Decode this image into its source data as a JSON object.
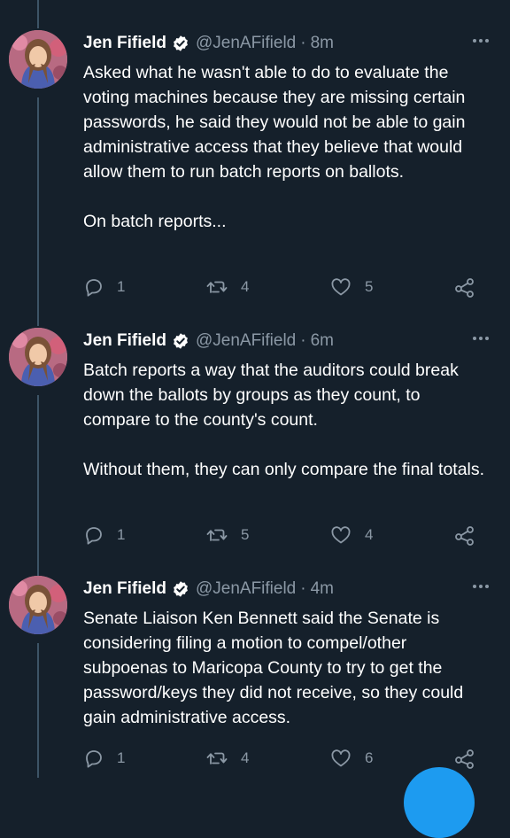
{
  "tweets": [
    {
      "name": "Jen Fifield",
      "handle": "@JenAFifield",
      "time": "8m",
      "paragraphs": [
        "Asked what he wasn't able to do to evaluate the voting machines because they are missing certain passwords, he said they would not be able to gain administrative access that they believe that would allow them to run batch reports on ballots.",
        "On batch reports..."
      ],
      "replies": "1",
      "retweets": "4",
      "likes": "5"
    },
    {
      "name": "Jen Fifield",
      "handle": "@JenAFifield",
      "time": "6m",
      "paragraphs": [
        "Batch reports a way that the auditors could break down the ballots by groups as they count, to compare to the county's count.",
        "Without them, they can only compare the final totals."
      ],
      "replies": "1",
      "retweets": "5",
      "likes": "4"
    },
    {
      "name": "Jen Fifield",
      "handle": "@JenAFifield",
      "time": "4m",
      "paragraphs": [
        "Senate Liaison Ken Bennett said the Senate is considering filing a motion to compel/other subpoenas to Maricopa County to try to get the password/keys they did not receive, so they could gain administrative access."
      ],
      "replies": "1",
      "retweets": "4",
      "likes": "6"
    }
  ],
  "separator": "·",
  "colors": {
    "background": "#15202b",
    "secondary_text": "#8b98a5",
    "verified": "#ffffff",
    "accent": "#1d9bf0"
  },
  "icons": [
    "verified-badge-icon",
    "more-icon",
    "reply-icon",
    "retweet-icon",
    "like-icon",
    "share-icon"
  ]
}
